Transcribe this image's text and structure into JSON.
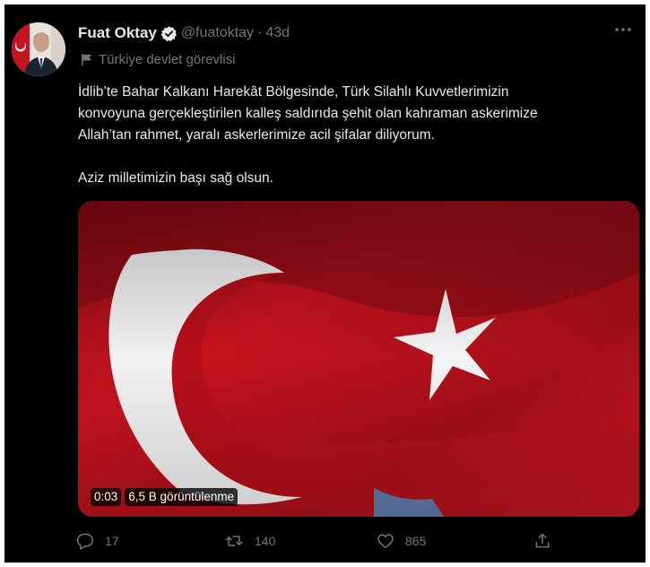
{
  "tweet": {
    "author_name": "Fuat Oktay",
    "handle": "@fuatoktay",
    "separator": "·",
    "time": "43d",
    "account_label": "Türkiye devlet görevlisi",
    "text_lines": [
      "İdlib’te Bahar Kalkanı Harekât Bölgesinde, Türk Silahlı Kuvvetlerimizin",
      "konvoyuna gerçekleştirilen kalleş saldırıda şehit olan kahraman askerimize",
      "Allah’tan rahmet, yaralı askerlerimize acil şifalar diliyorum."
    ],
    "text_closing": "Aziz milletimizin başı sağ olsun.",
    "media": {
      "type": "video",
      "subject": "turkish-flag",
      "duration": "0:03",
      "views": "6,5 B görüntülenme"
    },
    "actions": {
      "replies": "17",
      "retweets": "140",
      "likes": "865"
    }
  },
  "icons": {
    "verified": "verified-badge-icon",
    "more": "more-dots-icon",
    "label": "flag-icon",
    "reply": "reply-icon",
    "retweet": "retweet-icon",
    "like": "heart-icon",
    "share": "share-icon"
  },
  "colors": {
    "background": "#000000",
    "text_primary": "#e7e9ea",
    "text_secondary": "#71767b",
    "flag_red": "#c8101e",
    "flag_white": "#ffffff"
  }
}
